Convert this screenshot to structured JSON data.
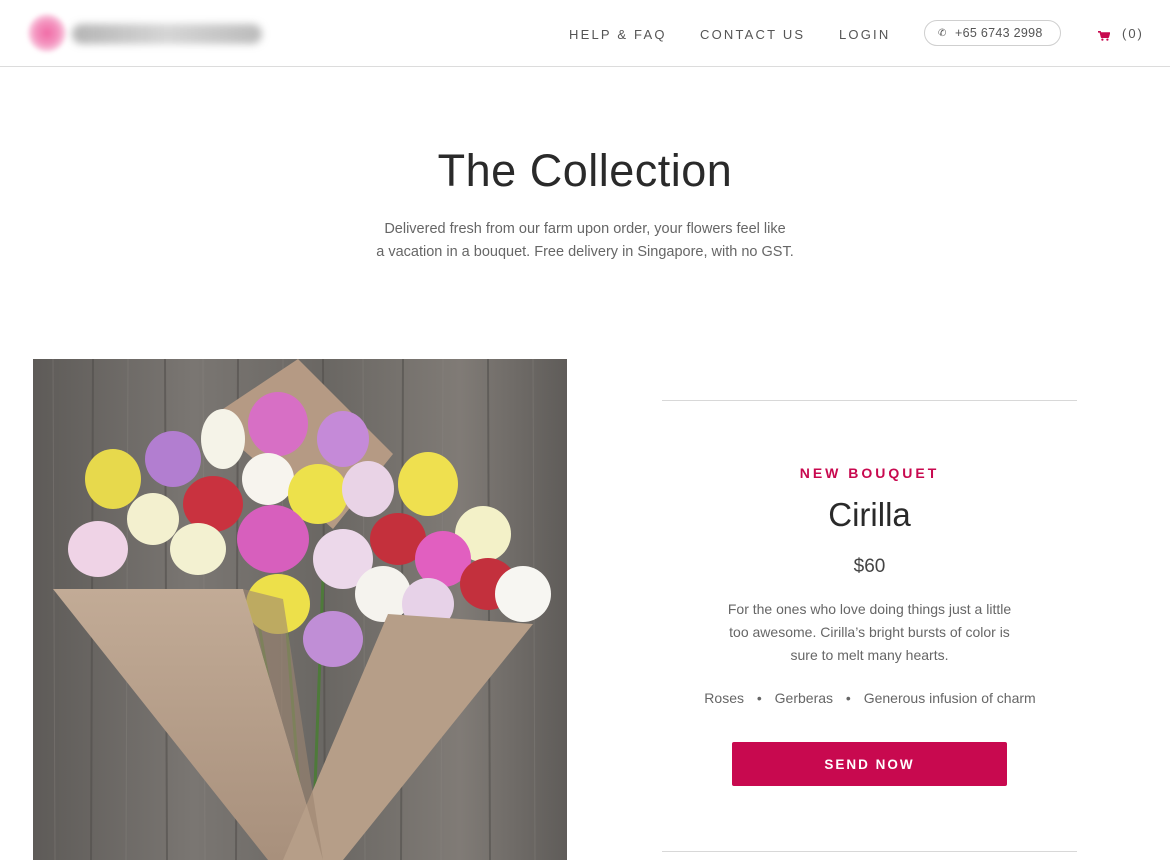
{
  "header": {
    "nav": [
      "HELP & FAQ",
      "CONTACT US",
      "LOGIN"
    ],
    "phone": "+65 6743 2998",
    "cart_count": "(0)"
  },
  "hero": {
    "title": "The Collection",
    "subtitle_line1": "Delivered fresh from our farm upon order, your flowers feel like",
    "subtitle_line2": "a vacation in a bouquet. Free delivery in Singapore, with no GST."
  },
  "product": {
    "eyebrow": "NEW BOUQUET",
    "name": "Cirilla",
    "price": "$60",
    "description_lines": [
      "For the ones who love doing things just a little",
      "too awesome. Cirilla’s bright bursts of color is",
      "sure to melt many hearts."
    ],
    "features": [
      "Roses",
      "Gerberas",
      "Generous infusion of charm"
    ],
    "feature_separator": "•",
    "cta_label": "SEND NOW"
  },
  "colors": {
    "accent": "#c8094f",
    "divider": "#d8d8d8",
    "text": "#2a2a2a"
  },
  "icons": {
    "phone": "phone-icon",
    "cart": "cart-icon"
  }
}
